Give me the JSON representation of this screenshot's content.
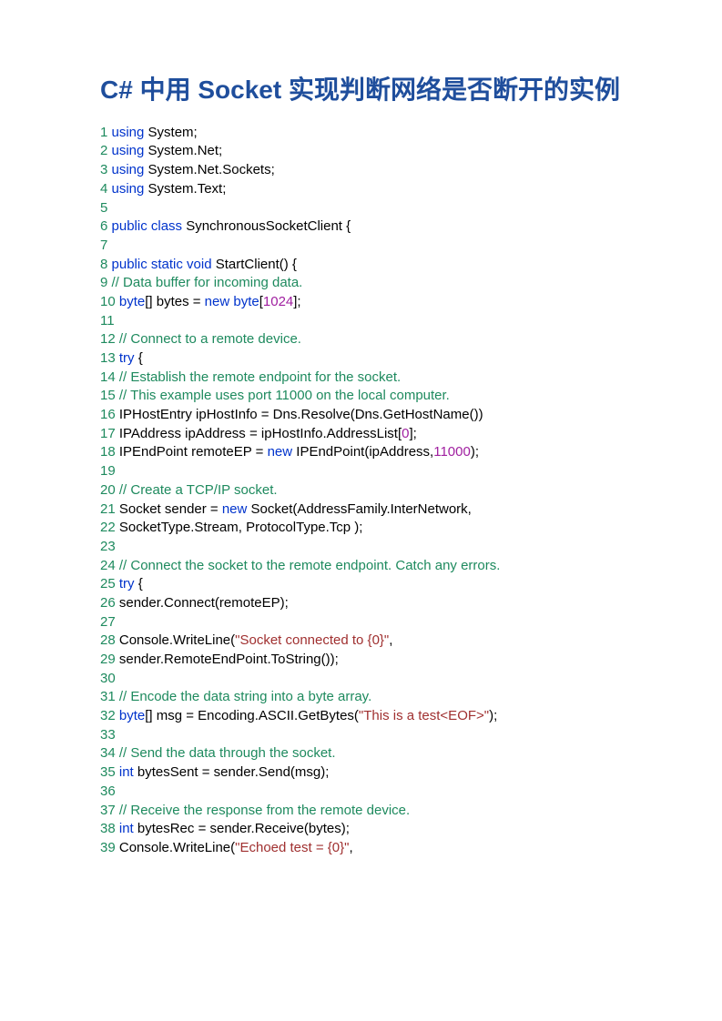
{
  "title": "C# 中用 Socket 实现判断网络是否断开的实例",
  "lines": [
    {
      "n": "1",
      "parts": [
        {
          "c": "kw",
          "t": " using"
        },
        {
          "c": "txt",
          "t": " System;"
        }
      ]
    },
    {
      "n": "2",
      "parts": [
        {
          "c": "kw",
          "t": " using"
        },
        {
          "c": "txt",
          "t": " System.Net;"
        }
      ]
    },
    {
      "n": "3",
      "parts": [
        {
          "c": "kw",
          "t": " using"
        },
        {
          "c": "txt",
          "t": " System.Net.Sockets;"
        }
      ]
    },
    {
      "n": "4",
      "parts": [
        {
          "c": "kw",
          "t": " using"
        },
        {
          "c": "txt",
          "t": " System.Text;"
        }
      ]
    },
    {
      "n": "5",
      "parts": []
    },
    {
      "n": "6",
      "parts": [
        {
          "c": "kw",
          "t": " public class"
        },
        {
          "c": "txt",
          "t": " SynchronousSocketClient {"
        }
      ]
    },
    {
      "n": "7",
      "parts": []
    },
    {
      "n": "8",
      "parts": [
        {
          "c": "kw",
          "t": " public static void"
        },
        {
          "c": "txt",
          "t": " StartClient() {"
        }
      ]
    },
    {
      "n": "9",
      "parts": [
        {
          "c": "cm",
          "t": " // Data buffer for incoming data."
        }
      ]
    },
    {
      "n": "10",
      "parts": [
        {
          "c": "kw",
          "t": " byte"
        },
        {
          "c": "txt",
          "t": "[] bytes = "
        },
        {
          "c": "kw",
          "t": "new byte"
        },
        {
          "c": "txt",
          "t": "["
        },
        {
          "c": "num",
          "t": "1024"
        },
        {
          "c": "txt",
          "t": "];"
        }
      ]
    },
    {
      "n": "11",
      "parts": []
    },
    {
      "n": "12",
      "parts": [
        {
          "c": "cm",
          "t": " // Connect to a remote device."
        }
      ]
    },
    {
      "n": "13",
      "parts": [
        {
          "c": "kw",
          "t": " try"
        },
        {
          "c": "txt",
          "t": " {"
        }
      ]
    },
    {
      "n": "14",
      "parts": [
        {
          "c": "cm",
          "t": " // Establish the remote endpoint for the socket."
        }
      ]
    },
    {
      "n": "15",
      "parts": [
        {
          "c": "cm",
          "t": " // This example uses port 11000 on the local computer."
        }
      ]
    },
    {
      "n": "16",
      "parts": [
        {
          "c": "txt",
          "t": " IPHostEntry ipHostInfo = Dns.Resolve(Dns.GetHostName())"
        }
      ]
    },
    {
      "n": "17",
      "parts": [
        {
          "c": "txt",
          "t": " IPAddress ipAddress = ipHostInfo.AddressList["
        },
        {
          "c": "num",
          "t": "0"
        },
        {
          "c": "txt",
          "t": "];"
        }
      ]
    },
    {
      "n": "18",
      "parts": [
        {
          "c": "txt",
          "t": " IPEndPoint remoteEP = "
        },
        {
          "c": "kw",
          "t": "new"
        },
        {
          "c": "txt",
          "t": " IPEndPoint(ipAddress,"
        },
        {
          "c": "num",
          "t": "11000"
        },
        {
          "c": "txt",
          "t": ");"
        }
      ]
    },
    {
      "n": "19",
      "parts": []
    },
    {
      "n": "20",
      "parts": [
        {
          "c": "cm",
          "t": " // Create a TCP/IP socket."
        }
      ]
    },
    {
      "n": "21",
      "parts": [
        {
          "c": "txt",
          "t": " Socket sender = "
        },
        {
          "c": "kw",
          "t": "new"
        },
        {
          "c": "txt",
          "t": " Socket(AddressFamily.InterNetwork,"
        }
      ]
    },
    {
      "n": "22",
      "parts": [
        {
          "c": "txt",
          "t": " SocketType.Stream, ProtocolType.Tcp );"
        }
      ]
    },
    {
      "n": "23",
      "parts": []
    },
    {
      "n": "24",
      "parts": [
        {
          "c": "cm",
          "t": " // Connect the socket to the remote endpoint. Catch any errors."
        }
      ]
    },
    {
      "n": "25",
      "parts": [
        {
          "c": "kw",
          "t": " try"
        },
        {
          "c": "txt",
          "t": " {"
        }
      ]
    },
    {
      "n": "26",
      "parts": [
        {
          "c": "txt",
          "t": " sender.Connect(remoteEP);"
        }
      ]
    },
    {
      "n": "27",
      "parts": []
    },
    {
      "n": "28",
      "parts": [
        {
          "c": "txt",
          "t": " Console.WriteLine("
        },
        {
          "c": "str",
          "t": "\"Socket connected to {0}\""
        },
        {
          "c": "txt",
          "t": ","
        }
      ]
    },
    {
      "n": "29",
      "parts": [
        {
          "c": "txt",
          "t": " sender.RemoteEndPoint.ToString());"
        }
      ]
    },
    {
      "n": "30",
      "parts": []
    },
    {
      "n": "31",
      "parts": [
        {
          "c": "cm",
          "t": " // Encode the data string into a byte array."
        }
      ]
    },
    {
      "n": "32",
      "parts": [
        {
          "c": "kw",
          "t": " byte"
        },
        {
          "c": "txt",
          "t": "[] msg = Encoding.ASCII.GetBytes("
        },
        {
          "c": "str",
          "t": "\"This is a test<EOF>\""
        },
        {
          "c": "txt",
          "t": ");"
        }
      ]
    },
    {
      "n": "33",
      "parts": []
    },
    {
      "n": "34",
      "parts": [
        {
          "c": "cm",
          "t": " // Send the data through the socket."
        }
      ]
    },
    {
      "n": "35",
      "parts": [
        {
          "c": "kw",
          "t": " int"
        },
        {
          "c": "txt",
          "t": " bytesSent = sender.Send(msg);"
        }
      ]
    },
    {
      "n": "36",
      "parts": []
    },
    {
      "n": "37",
      "parts": [
        {
          "c": "cm",
          "t": " // Receive the response from the remote device."
        }
      ]
    },
    {
      "n": "38",
      "parts": [
        {
          "c": "kw",
          "t": " int"
        },
        {
          "c": "txt",
          "t": " bytesRec = sender.Receive(bytes);"
        }
      ]
    },
    {
      "n": "39",
      "parts": [
        {
          "c": "txt",
          "t": " Console.WriteLine("
        },
        {
          "c": "str",
          "t": "\"Echoed test = {0}\""
        },
        {
          "c": "txt",
          "t": ","
        }
      ]
    }
  ]
}
